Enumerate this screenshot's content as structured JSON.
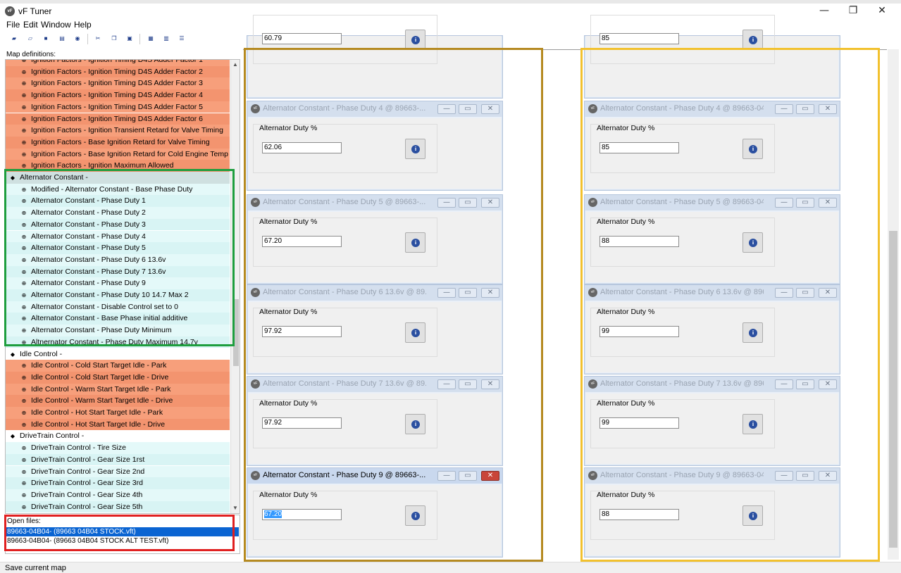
{
  "app": {
    "title": "vF Tuner",
    "icon": "vf-logo-icon"
  },
  "menu": [
    "File",
    "Edit",
    "Window",
    "Help"
  ],
  "window_controls": {
    "minimize": "—",
    "maximize": "❐",
    "close": "✕"
  },
  "toolbar": [
    "open-icon",
    "reload-icon",
    "save-icon",
    "export-icon",
    "compare-icon",
    "cut-icon",
    "copy-icon",
    "paste-icon",
    "tile-icon",
    "cascade-icon",
    "list-icon"
  ],
  "sidebar": {
    "header": "Map definitions:",
    "items": [
      {
        "label": "Ignition Factors - Ignition Timing D4S Adder Factor 1",
        "type": "orange"
      },
      {
        "label": "Ignition Factors - Ignition Timing D4S Adder Factor 2",
        "type": "orange"
      },
      {
        "label": "Ignition Factors - Ignition Timing D4S Adder Factor 3",
        "type": "orange"
      },
      {
        "label": "Ignition Factors - Ignition Timing D4S Adder Factor 4",
        "type": "orange"
      },
      {
        "label": "Ignition Factors - Ignition Timing D4S Adder Factor 5",
        "type": "orange"
      },
      {
        "label": "Ignition Factors - Ignition Timing D4S Adder Factor 6",
        "type": "orange"
      },
      {
        "label": "Ignition Factors - Ignition Transient Retard for Valve Timing",
        "type": "orange"
      },
      {
        "label": "Ignition Factors - Base Ignition Retard for Valve Timing",
        "type": "orange"
      },
      {
        "label": "Ignition Factors - Base Ignition Retard for Cold Engine Temp",
        "type": "orange"
      },
      {
        "label": "Ignition Factors - Ignition Maximum Allowed",
        "type": "orange"
      },
      {
        "label": "Alternator Constant -",
        "type": "group-active"
      },
      {
        "label": "Modified - Alternator Constant - Base Phase Duty",
        "type": "cyan"
      },
      {
        "label": "Alternator Constant - Phase Duty 1",
        "type": "cyan"
      },
      {
        "label": "Alternator Constant - Phase Duty 2",
        "type": "cyan"
      },
      {
        "label": "Alternator Constant - Phase Duty 3",
        "type": "cyan"
      },
      {
        "label": "Alternator Constant - Phase Duty 4",
        "type": "cyan"
      },
      {
        "label": "Alternator Constant - Phase Duty 5",
        "type": "cyan"
      },
      {
        "label": "Alternator Constant - Phase Duty 6 13.6v",
        "type": "cyan"
      },
      {
        "label": "Alternator Constant - Phase Duty 7 13.6v",
        "type": "cyan"
      },
      {
        "label": "Alternator Constant - Phase Duty 9",
        "type": "cyan"
      },
      {
        "label": "Alternator Constant - Phase Duty 10 14.7 Max 2",
        "type": "cyan"
      },
      {
        "label": "Alternator Constant - Disable Control set to 0",
        "type": "cyan"
      },
      {
        "label": "Alternator Constant - Base Phase initial additive",
        "type": "cyan"
      },
      {
        "label": "Alternator Constant - Phase Duty Minimum",
        "type": "cyan"
      },
      {
        "label": "Altnernator Constant - Phase Duty Maximum 14.7v",
        "type": "cyan"
      },
      {
        "label": "Idle Control -",
        "type": "group"
      },
      {
        "label": "Idle Control - Cold Start Target Idle - Park",
        "type": "orange"
      },
      {
        "label": "Idle Control - Cold Start Target Idle - Drive",
        "type": "orange"
      },
      {
        "label": "Idle Control - Warm Start Target Idle - Park",
        "type": "orange"
      },
      {
        "label": "Idle Control - Warm Start Target Idle - Drive",
        "type": "orange"
      },
      {
        "label": "Idle Control - Hot Start Target Idle - Park",
        "type": "orange"
      },
      {
        "label": "Idle Control - Hot Start Target Idle - Drive",
        "type": "orange"
      },
      {
        "label": "DriveTrain Control -",
        "type": "group"
      },
      {
        "label": "DriveTrain Control - Tire Size",
        "type": "cyan"
      },
      {
        "label": "DriveTrain Control - Gear Size 1rst",
        "type": "cyan"
      },
      {
        "label": "DriveTrain Control - Gear Size 2nd",
        "type": "cyan"
      },
      {
        "label": "DriveTrain Control - Gear Size 3rd",
        "type": "cyan"
      },
      {
        "label": "DriveTrain Control - Gear Size 4th",
        "type": "cyan"
      },
      {
        "label": "DriveTrain Control - Gear Size 5th",
        "type": "cyan"
      }
    ]
  },
  "open_files": {
    "title": "Open files:",
    "files": [
      {
        "label": "89663-04B04- (89663 04B04 STOCK.vft)",
        "selected": true
      },
      {
        "label": "89663-04B04- (89663 04B04 STOCK ALT TEST.vft)",
        "selected": false
      }
    ]
  },
  "status": "Save current map",
  "colors": {
    "orange": "#f79f7b",
    "orange_alt": "#f3946f",
    "cyan": "#d8f4f4",
    "cyan_alt": "#e4f9f9",
    "group": "#ffffff",
    "group_active": "#cfe0e0",
    "green_box": "#1e9e3e",
    "red_box": "#e02020",
    "olive_box": "#b58a21",
    "yellow_box": "#f2c12e"
  },
  "windows_left": [
    {
      "title": "",
      "label": "",
      "value": "60.79",
      "active": false,
      "partial": true
    },
    {
      "title": "Alternator Constant - Phase Duty 4 @ 89663-...",
      "label": "Alternator Duty %",
      "value": "62.06",
      "active": false
    },
    {
      "title": "Alternator Constant - Phase Duty 5 @ 89663-...",
      "label": "Alternator Duty %",
      "value": "67.20",
      "active": false
    },
    {
      "title": "Alternator Constant - Phase Duty 6 13.6v @ 89...",
      "label": "Alternator Duty %",
      "value": "97.92",
      "active": false
    },
    {
      "title": "Alternator Constant - Phase Duty 7 13.6v @ 89...",
      "label": "Alternator Duty %",
      "value": "97.92",
      "active": false
    },
    {
      "title": "Alternator Constant - Phase Duty 9 @ 89663-...",
      "label": "Alternator Duty %",
      "value": "67.20",
      "active": true
    }
  ],
  "windows_right": [
    {
      "title": "",
      "label": "",
      "value": "85",
      "active": false,
      "partial": true
    },
    {
      "title": "Alternator Constant - Phase Duty 4 @ 89663-04B...",
      "label": "Alternator Duty %",
      "value": "85",
      "active": false
    },
    {
      "title": "Alternator Constant - Phase Duty 5 @ 89663-04B...",
      "label": "Alternator Duty %",
      "value": "88",
      "active": false
    },
    {
      "title": "Alternator Constant - Phase Duty 6 13.6v @ 8966...",
      "label": "Alternator Duty %",
      "value": "99",
      "active": false
    },
    {
      "title": "Alternator Constant - Phase Duty 7 13.6v @ 8966...",
      "label": "Alternator Duty %",
      "value": "99",
      "active": false
    },
    {
      "title": "Alternator Constant - Phase Duty 9 @ 89663-04B...",
      "label": "Alternator Duty %",
      "value": "88",
      "active": false
    }
  ],
  "subwin_controls": {
    "minimize": "—",
    "restore": "▭",
    "close": "✕"
  },
  "info_glyph": "i"
}
